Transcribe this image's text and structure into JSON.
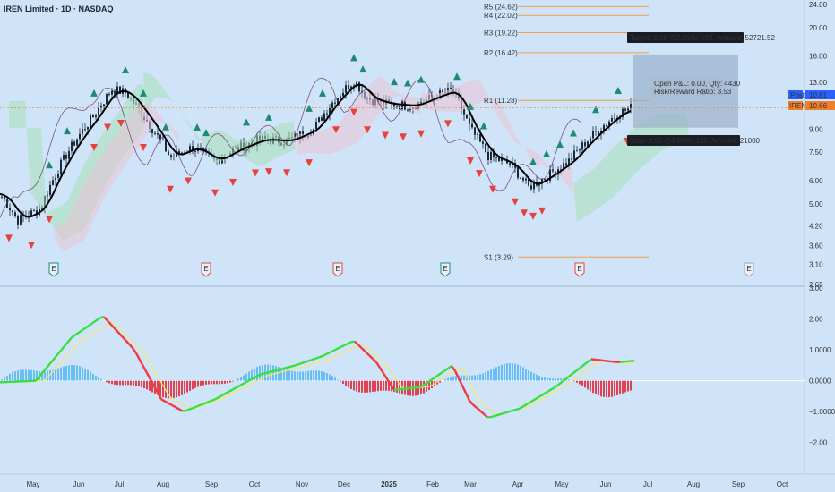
{
  "header": {
    "symbol_line": "IREN Limited · 1D · NASDAQ"
  },
  "colors": {
    "bg": "#cfe4f9",
    "up": "#1f8a72",
    "down": "#e8413b",
    "candle": "#1b2a3a",
    "ma": "#000000",
    "cloud_green": "#a8dfb6",
    "cloud_red": "#e9c4d4",
    "purple": "#6a2c6e",
    "pivot": "#f0a046",
    "macd_green": "#39e03c",
    "macd_red": "#f33a3a",
    "hist_blue": "#5bb8f5",
    "hist_red": "#e0313e"
  },
  "price_axis": {
    "ticks": [
      "24.00",
      "20.00",
      "16.00",
      "13.00",
      "11.00",
      "9.00",
      "7.50",
      "6.00",
      "5.00",
      "4.20",
      "3.60",
      "3.10",
      "2.65"
    ],
    "post_label": "Post",
    "post_value": "10.81",
    "sym_label": "IREN",
    "sym_value": "10.66"
  },
  "macd_axis": {
    "ticks": [
      "3.00",
      "2.00",
      "1.0000",
      "0.0000",
      "−1.0000",
      "−2.00"
    ]
  },
  "time_axis": {
    "ticks": [
      "May",
      "Jun",
      "Jul",
      "Aug",
      "Sep",
      "Oct",
      "Nov",
      "Dec",
      "2025",
      "Feb",
      "Mar",
      "Apr",
      "May",
      "Jun",
      "Jul",
      "Aug",
      "Sep",
      "Oct"
    ]
  },
  "pivots": [
    {
      "label": "R5 (24.62)"
    },
    {
      "label": "R4 (22.02)"
    },
    {
      "label": "R3 (19.22)"
    },
    {
      "label": "R2 (16.42)"
    },
    {
      "label": "R1 (11.28)"
    },
    {
      "label": "S1 (3.29)"
    }
  ],
  "trade": {
    "target": "Target: 5.58 (52.35%) 558, Amount: 52721.52",
    "open_pnl": "Open P&L: 0.00, Qty: 4430",
    "rr": "Risk/Reward Ratio: 3.53",
    "stop": "Stop: 1.56 (14.82%) 158, Amount: 21000"
  },
  "earnings": [
    {
      "label": "E",
      "color": "green"
    },
    {
      "label": "E",
      "color": "red"
    },
    {
      "label": "E",
      "color": "red"
    },
    {
      "label": "E",
      "color": "green"
    },
    {
      "label": "E",
      "color": "red"
    },
    {
      "label": "E",
      "color": "gray"
    }
  ],
  "chart_data": {
    "type": "line",
    "title": "IREN Limited · 1D · NASDAQ",
    "xlabel": "",
    "ylabel": "",
    "y_scale": "log",
    "ylim": [
      2.65,
      24.0
    ],
    "x": [
      "May",
      "Jun",
      "Jul",
      "Aug",
      "Sep",
      "Oct",
      "Nov",
      "Dec",
      "2025",
      "Feb",
      "Mar",
      "Apr",
      "May",
      "Jun"
    ],
    "series": [
      {
        "values": [
          4.6,
          8.0,
          12.0,
          7.5,
          7.2,
          8.2,
          8.8,
          13.0,
          11.5,
          11.2,
          7.0,
          5.8,
          7.5,
          10.7
        ]
      }
    ],
    "last_close": 10.66,
    "macd_ylim": [
      -2.5,
      3.0
    ],
    "grid": false,
    "legend": "top-left"
  }
}
